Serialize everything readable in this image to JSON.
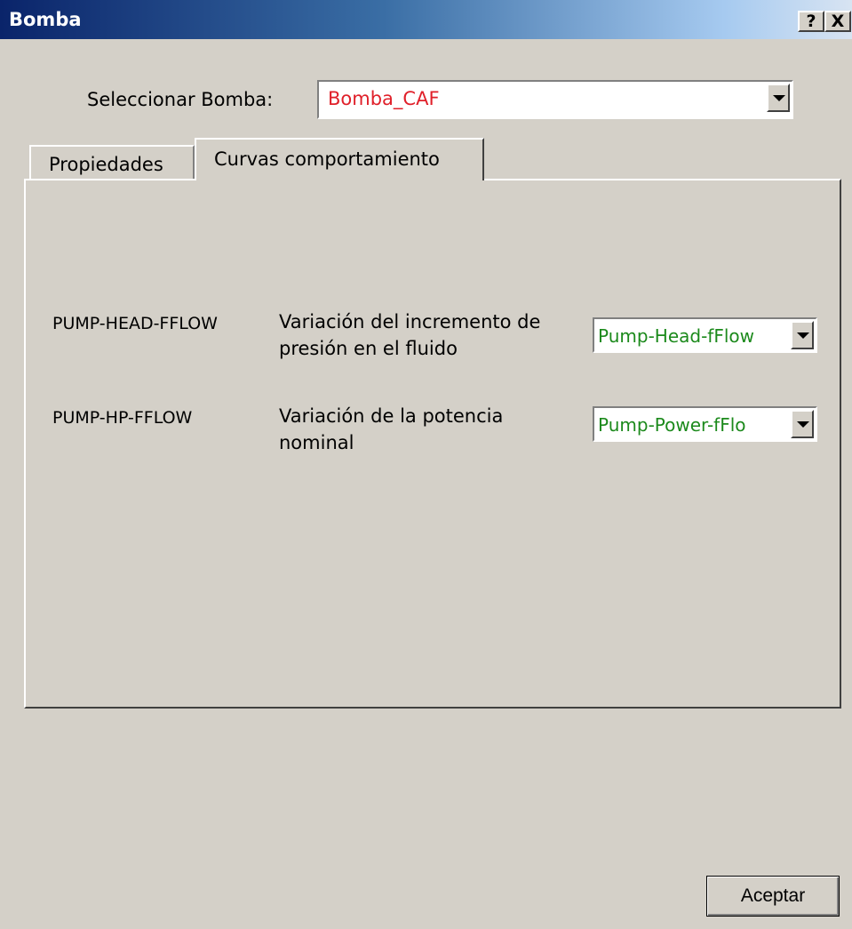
{
  "window": {
    "title": "Bomba",
    "help_label": "?",
    "close_label": "X"
  },
  "pump_selector": {
    "label": "Seleccionar Bomba:",
    "value": "Bomba_CAF",
    "value_color": "#e0202a"
  },
  "tabs": [
    {
      "label": "Propiedades",
      "active": false
    },
    {
      "label": "Curvas comportamiento",
      "active": true
    }
  ],
  "curves": [
    {
      "code": "PUMP-HEAD-FFLOW",
      "description_line1": "Variación del incremento de",
      "description_line2": "presión en el fluido",
      "selected": "Pump-Head-fFlow"
    },
    {
      "code": "PUMP-HP-FFLOW",
      "description_line1": "Variación de la potencia",
      "description_line2": "nominal",
      "selected": "Pump-Power-fFlo"
    }
  ],
  "colors": {
    "selected_curve_text": "#1c8a1c",
    "dialog_background": "#d4d0c8"
  },
  "footer": {
    "ok_label": "Aceptar"
  }
}
